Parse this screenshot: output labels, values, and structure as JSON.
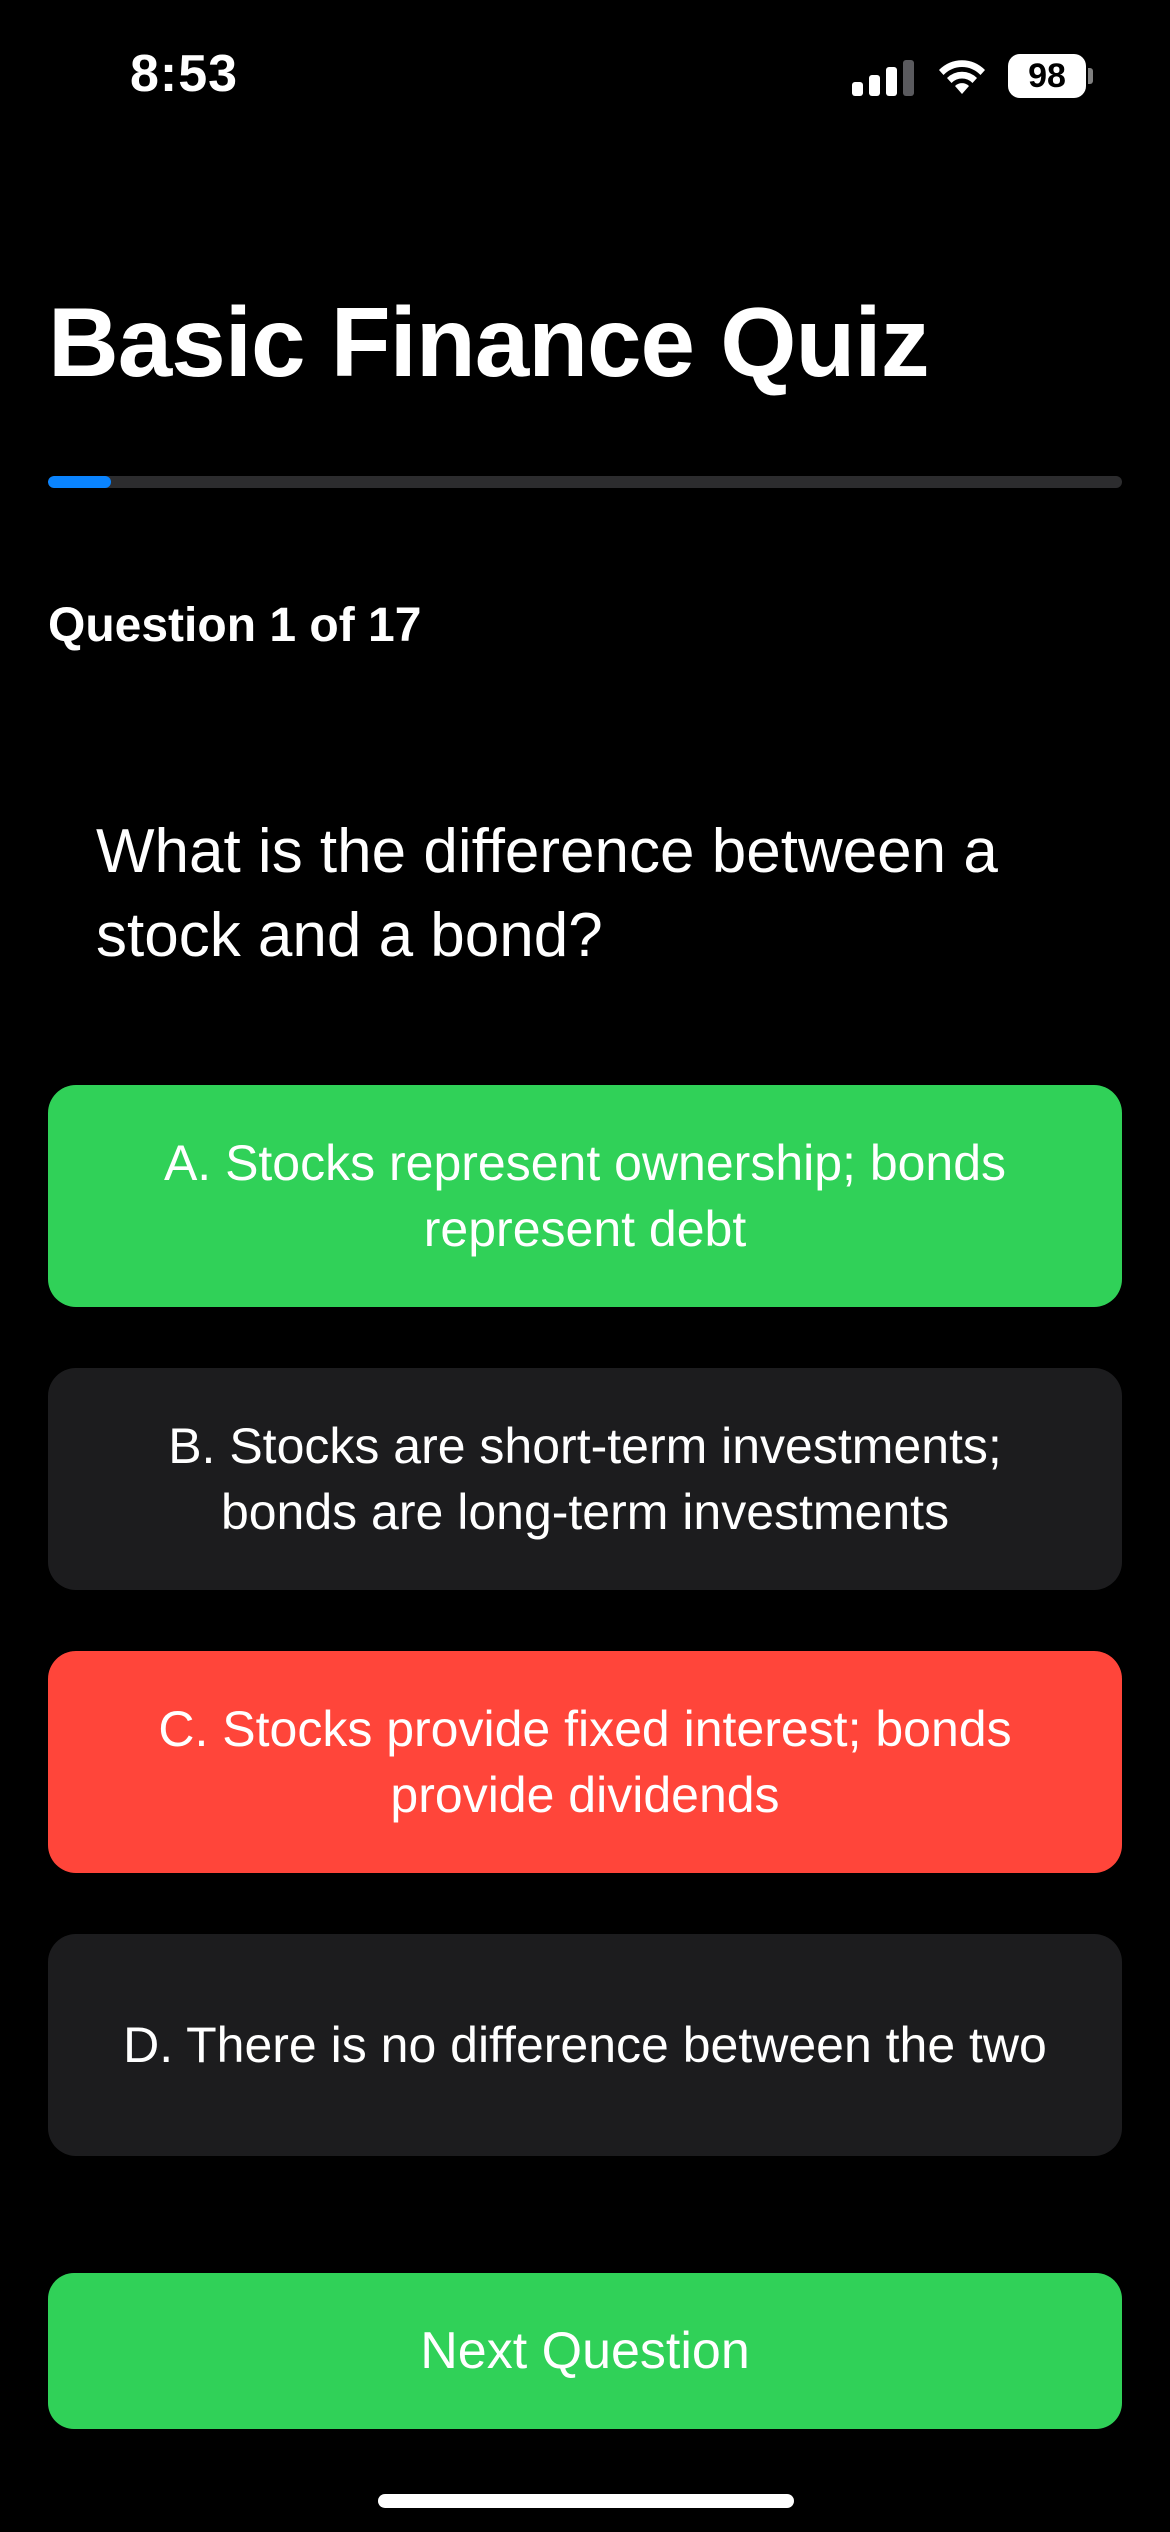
{
  "status_bar": {
    "time": "8:53",
    "battery_level": "98",
    "signal_icon": "cellular-signal-icon",
    "wifi_icon": "wifi-icon",
    "battery_icon": "battery-icon"
  },
  "quiz": {
    "title": "Basic Finance Quiz",
    "progress_fraction": 0.0588,
    "question_counter": "Question 1 of 17",
    "question": "What is the difference between a stock and a bond?",
    "answers": [
      {
        "label": "A. Stocks represent ownership; bonds represent debt",
        "state": "correct"
      },
      {
        "label": "B. Stocks are short-term investments; bonds are long-term investments",
        "state": "neutral"
      },
      {
        "label": "C. Stocks provide fixed interest; bonds provide dividends",
        "state": "incorrect"
      },
      {
        "label": "D. There is no difference between the two",
        "state": "neutral"
      }
    ],
    "next_button_label": "Next Question"
  },
  "colors": {
    "background": "#000000",
    "correct": "#30d158",
    "incorrect": "#ff453a",
    "neutral": "#1c1c1e",
    "progress": "#0a84ff",
    "track": "#2c2c2e"
  }
}
